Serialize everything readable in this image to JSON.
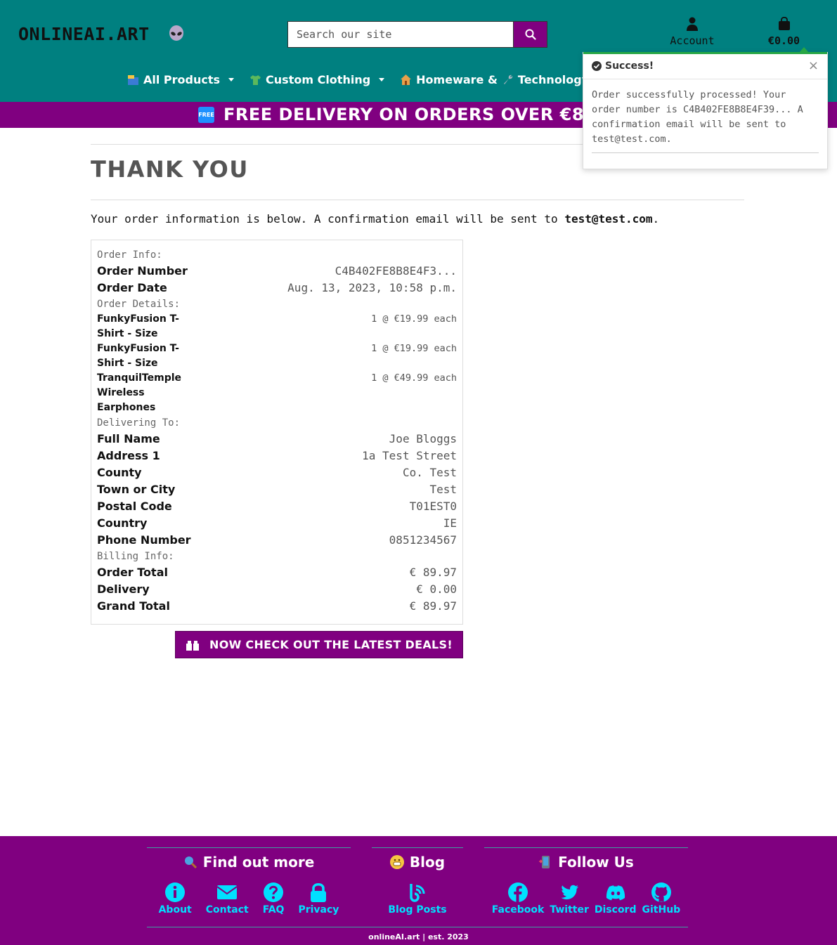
{
  "brand": {
    "logo_text": "ONLINEAI.ART"
  },
  "search": {
    "placeholder": "Search our site"
  },
  "account": {
    "label": "Account"
  },
  "cart": {
    "total": "€0.00"
  },
  "nav": {
    "items": [
      {
        "label": "All Products",
        "icon": "package-icon",
        "dropdown": true
      },
      {
        "label": "Custom Clothing",
        "icon": "tshirt-icon",
        "dropdown": true
      },
      {
        "label": "Homeware & ",
        "icon": "house-icon",
        "dropdown": false
      },
      {
        "label": "Technology",
        "icon": "wrench-icon",
        "dropdown": false
      }
    ]
  },
  "banner": {
    "badge": "FREE",
    "text": "FREE DELIVERY ON ORDERS OVER €8"
  },
  "toast": {
    "title": "Success!",
    "close": "×",
    "message": "Order successfully processed! Your order number is C4B402FE8B8E4F39... A confirmation email will be sent to test@test.com."
  },
  "page": {
    "title": "THANK YOU",
    "intro": "Your order information is below. A confirmation email will be sent to",
    "email": "test@test.com",
    "intro_end": "."
  },
  "order_info": {
    "heading": "Order Info:",
    "number_label": "Order Number",
    "number_value": "C4B402FE8B8E4F3...",
    "date_label": "Order Date",
    "date_value": "Aug. 13, 2023, 10:58 p.m."
  },
  "order_details": {
    "heading": "Order Details:",
    "items": [
      {
        "name": "FunkyFusion T-Shirt - Size",
        "qty_price": "1 @ €19.99 each"
      },
      {
        "name": "FunkyFusion T-Shirt - Size",
        "qty_price": "1 @ €19.99 each"
      },
      {
        "name": "TranquilTemple Wireless Earphones",
        "qty_price": "1 @ €49.99 each"
      }
    ]
  },
  "delivering": {
    "heading": "Delivering To:",
    "rows": [
      {
        "label": "Full Name",
        "value": "Joe Bloggs"
      },
      {
        "label": "Address 1",
        "value": "1a Test Street"
      },
      {
        "label": "County",
        "value": "Co. Test"
      },
      {
        "label": "Town or City",
        "value": "Test"
      },
      {
        "label": "Postal Code",
        "value": "T01EST0"
      },
      {
        "label": "Country",
        "value": "IE"
      },
      {
        "label": "Phone Number",
        "value": "0851234567"
      }
    ]
  },
  "billing": {
    "heading": "Billing Info:",
    "rows": [
      {
        "label": "Order Total",
        "value": "€ 89.97"
      },
      {
        "label": "Delivery",
        "value": "€ 0.00"
      },
      {
        "label": "Grand Total",
        "value": "€ 89.97"
      }
    ]
  },
  "deals_button": {
    "label": "NOW CHECK OUT THE LATEST DEALS!",
    "icon": "gift-icon"
  },
  "footer": {
    "find_out_more": {
      "heading": "Find out more",
      "links": [
        {
          "label": "About",
          "icon": "info-icon"
        },
        {
          "label": "Contact",
          "icon": "envelope-icon"
        },
        {
          "label": "FAQ",
          "icon": "question-icon"
        },
        {
          "label": "Privacy",
          "icon": "lock-icon"
        }
      ]
    },
    "blog": {
      "heading": "Blog",
      "links": [
        {
          "label": "Blog Posts",
          "icon": "blog-icon"
        }
      ]
    },
    "follow": {
      "heading": "Follow Us",
      "links": [
        {
          "label": "Facebook",
          "icon": "facebook-icon"
        },
        {
          "label": "Twitter",
          "icon": "twitter-icon"
        },
        {
          "label": "Discord",
          "icon": "discord-icon"
        },
        {
          "label": "GitHub",
          "icon": "github-icon"
        }
      ]
    },
    "copyright": "onlineAI.art | est. 2023"
  },
  "colors": {
    "teal": "#008080",
    "purple": "#800080",
    "cyan_link": "#00e0ff"
  }
}
